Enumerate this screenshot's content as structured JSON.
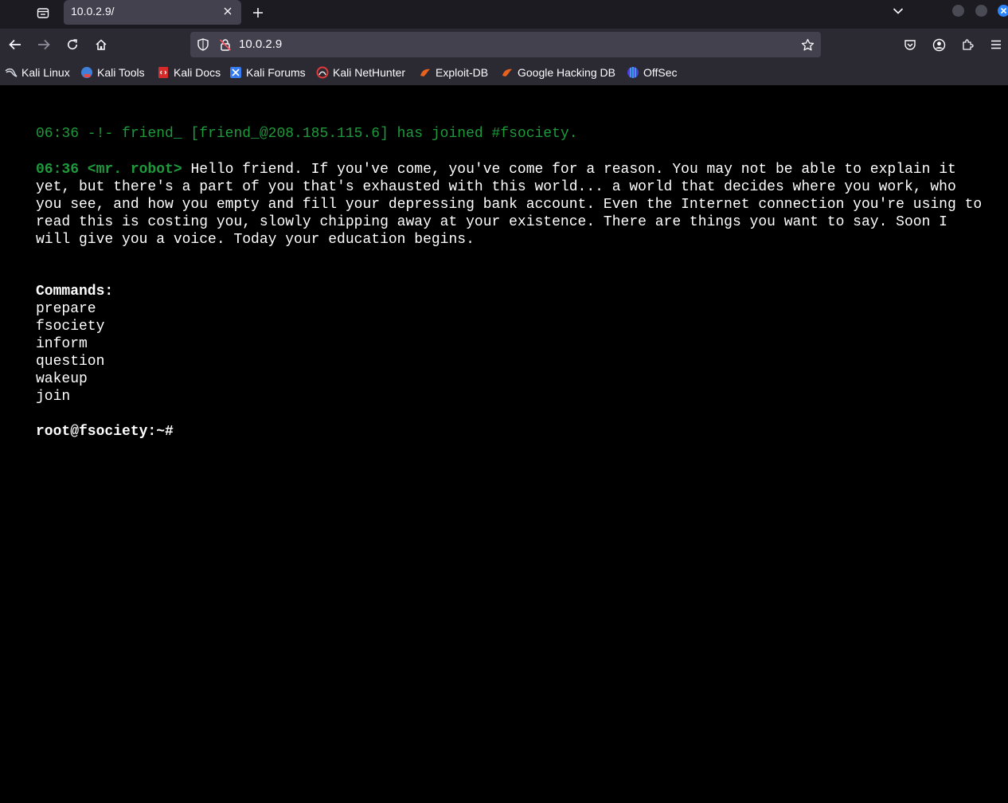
{
  "browser": {
    "tab": {
      "title": "10.0.2.9/"
    },
    "url": "10.0.2.9",
    "bookmarks": [
      {
        "label": "Kali Linux",
        "icon": "kali-dragon-icon"
      },
      {
        "label": "Kali Tools",
        "icon": "kali-tools-icon"
      },
      {
        "label": "Kali Docs",
        "icon": "kali-docs-icon"
      },
      {
        "label": "Kali Forums",
        "icon": "kali-forums-icon"
      },
      {
        "label": "Kali NetHunter",
        "icon": "nethunter-icon"
      },
      {
        "label": "Exploit-DB",
        "icon": "exploit-db-icon"
      },
      {
        "label": "Google Hacking DB",
        "icon": "ghdb-icon"
      },
      {
        "label": "OffSec",
        "icon": "offsec-icon"
      }
    ]
  },
  "terminal": {
    "join_line": "06:36 -!- friend_ [friend_@208.185.115.6] has joined #fsociety.",
    "message": {
      "timestamp_nick": "06:36 <mr. robot>",
      "text": "Hello friend. If you've come, you've come for a reason. You may not be able to explain it yet, but there's a part of you that's exhausted with this world... a world that decides where you work, who you see, and how you empty and fill your depressing bank account. Even the Internet connection you're using to read this is costing you, slowly chipping away at your existence. There are things you want to say. Soon I will give you a voice. Today your education begins."
    },
    "commands_heading": "Commands:",
    "commands": [
      "prepare",
      "fsociety",
      "inform",
      "question",
      "wakeup",
      "join"
    ],
    "prompt": "root@fsociety:~#"
  },
  "colors": {
    "background": "#000000",
    "irc_green": "#1d9a3b",
    "text": "#ffffff",
    "chrome_dark": "#1c1b22",
    "chrome": "#2b2a33"
  }
}
